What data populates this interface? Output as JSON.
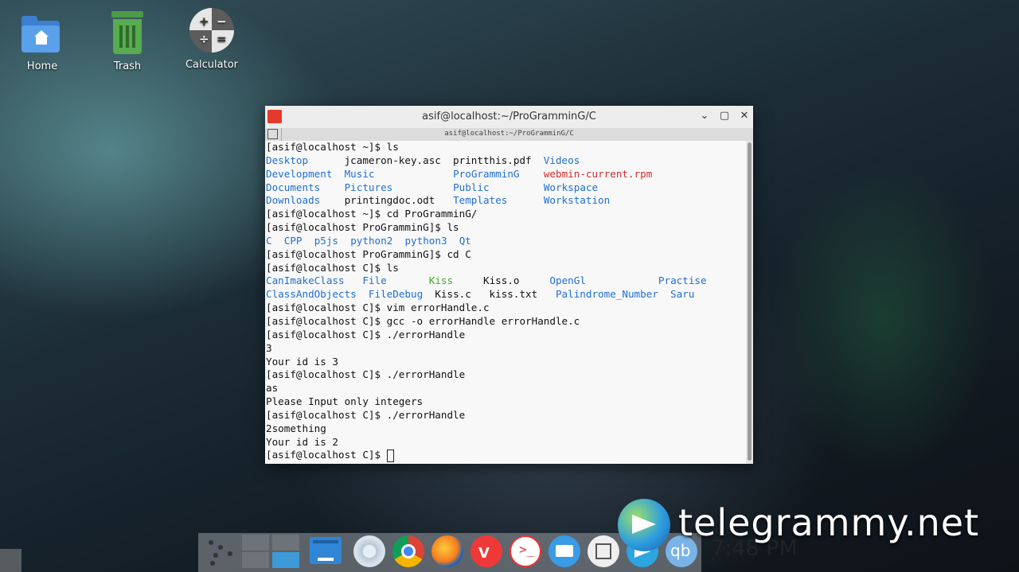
{
  "desktop": {
    "icons": [
      {
        "label": "Home",
        "icon": "home-folder-icon"
      },
      {
        "label": "Trash",
        "icon": "trash-icon"
      },
      {
        "label": "Calculator",
        "icon": "calculator-icon"
      }
    ]
  },
  "window": {
    "title": "asif@localhost:~/ProGramminG/C",
    "tab_title": "asif@localhost:~/ProGramminG/C",
    "buttons": {
      "minimize": "⌄",
      "maximize": "▢",
      "close": "✕"
    }
  },
  "terminal": {
    "colors": {
      "directory": "#1f6fd1",
      "archive": "#d42c2c",
      "executable": "#3fae2a",
      "text": "#111111"
    },
    "lines": [
      [
        {
          "t": "[asif@localhost ~]$ ls",
          "c": ""
        }
      ],
      [
        {
          "t": "Desktop",
          "c": "blue"
        },
        {
          "t": "      jcameron-key.asc  printthis.pdf  ",
          "c": ""
        },
        {
          "t": "Videos",
          "c": "blue"
        }
      ],
      [
        {
          "t": "Development",
          "c": "blue"
        },
        {
          "t": "  ",
          "c": ""
        },
        {
          "t": "Music",
          "c": "blue"
        },
        {
          "t": "             ",
          "c": ""
        },
        {
          "t": "ProGramminG",
          "c": "blue"
        },
        {
          "t": "    ",
          "c": ""
        },
        {
          "t": "webmin-current.rpm",
          "c": "red"
        }
      ],
      [
        {
          "t": "Documents",
          "c": "blue"
        },
        {
          "t": "    ",
          "c": ""
        },
        {
          "t": "Pictures",
          "c": "blue"
        },
        {
          "t": "          ",
          "c": ""
        },
        {
          "t": "Public",
          "c": "blue"
        },
        {
          "t": "         ",
          "c": ""
        },
        {
          "t": "Workspace",
          "c": "blue"
        }
      ],
      [
        {
          "t": "Downloads",
          "c": "blue"
        },
        {
          "t": "    printingdoc.odt   ",
          "c": ""
        },
        {
          "t": "Templates",
          "c": "blue"
        },
        {
          "t": "      ",
          "c": ""
        },
        {
          "t": "Workstation",
          "c": "blue"
        }
      ],
      [
        {
          "t": "[asif@localhost ~]$ cd ProGramminG/",
          "c": ""
        }
      ],
      [
        {
          "t": "[asif@localhost ProGramminG]$ ls",
          "c": ""
        }
      ],
      [
        {
          "t": "C",
          "c": "blue"
        },
        {
          "t": "  ",
          "c": ""
        },
        {
          "t": "CPP",
          "c": "blue"
        },
        {
          "t": "  ",
          "c": ""
        },
        {
          "t": "p5js",
          "c": "blue"
        },
        {
          "t": "  ",
          "c": ""
        },
        {
          "t": "python2",
          "c": "blue"
        },
        {
          "t": "  ",
          "c": ""
        },
        {
          "t": "python3",
          "c": "blue"
        },
        {
          "t": "  ",
          "c": ""
        },
        {
          "t": "Qt",
          "c": "blue"
        }
      ],
      [
        {
          "t": "[asif@localhost ProGramminG]$ cd C",
          "c": ""
        }
      ],
      [
        {
          "t": "[asif@localhost C]$ ls",
          "c": ""
        }
      ],
      [
        {
          "t": "CanImakeClass",
          "c": "blue"
        },
        {
          "t": "   ",
          "c": ""
        },
        {
          "t": "File",
          "c": "blue"
        },
        {
          "t": "       ",
          "c": ""
        },
        {
          "t": "Kiss",
          "c": "green"
        },
        {
          "t": "     Kiss.o     ",
          "c": ""
        },
        {
          "t": "OpenGl",
          "c": "blue"
        },
        {
          "t": "            ",
          "c": ""
        },
        {
          "t": "Practise",
          "c": "blue"
        }
      ],
      [
        {
          "t": "ClassAndObjects",
          "c": "blue"
        },
        {
          "t": "  ",
          "c": ""
        },
        {
          "t": "FileDebug",
          "c": "blue"
        },
        {
          "t": "  Kiss.c   kiss.txt   ",
          "c": ""
        },
        {
          "t": "Palindrome_Number",
          "c": "blue"
        },
        {
          "t": "  ",
          "c": ""
        },
        {
          "t": "Saru",
          "c": "blue"
        }
      ],
      [
        {
          "t": "[asif@localhost C]$ vim errorHandle.c",
          "c": ""
        }
      ],
      [
        {
          "t": "[asif@localhost C]$ gcc -o errorHandle errorHandle.c",
          "c": ""
        }
      ],
      [
        {
          "t": "[asif@localhost C]$ ./errorHandle",
          "c": ""
        }
      ],
      [
        {
          "t": "3",
          "c": ""
        }
      ],
      [
        {
          "t": "Your id is 3",
          "c": ""
        }
      ],
      [
        {
          "t": "[asif@localhost C]$ ./errorHandle",
          "c": ""
        }
      ],
      [
        {
          "t": "as",
          "c": ""
        }
      ],
      [
        {
          "t": "Please Input only integers",
          "c": ""
        }
      ],
      [
        {
          "t": "[asif@localhost C]$ ./errorHandle",
          "c": ""
        }
      ],
      [
        {
          "t": "2something",
          "c": ""
        }
      ],
      [
        {
          "t": "Your id is 2",
          "c": ""
        }
      ],
      [
        {
          "t": "[asif@localhost C]$ ",
          "c": ""
        }
      ]
    ]
  },
  "taskbar": {
    "clock": "7:48 PM",
    "dock_icons": [
      "app-launcher-icon",
      "workspace-switcher-icon",
      "file-manager-icon",
      "chromium-icon",
      "chrome-icon",
      "firefox-icon",
      "vivaldi-icon",
      "terminal-icon",
      "mail-icon",
      "archive-icon",
      "telegram-icon",
      "qbittorrent-icon"
    ],
    "qb_label": "qb"
  },
  "watermark": "telegrammy.net"
}
